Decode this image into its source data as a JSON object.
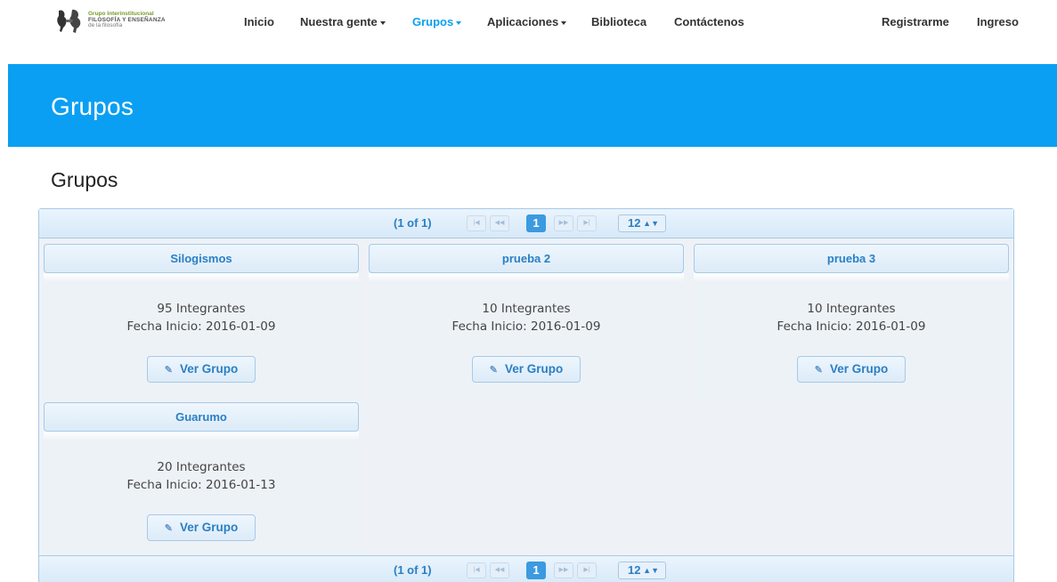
{
  "logo": {
    "line1": "Grupo Interinstitucional",
    "line2": "FILOSOFÍA Y ENSEÑANZA",
    "line3": "de la filosofía"
  },
  "nav": {
    "inicio": "Inicio",
    "nuestra_gente": "Nuestra gente",
    "grupos": "Grupos",
    "aplicaciones": "Aplicaciones",
    "biblioteca": "Biblioteca",
    "contactenos": "Contáctenos",
    "registrarme": "Registrarme",
    "ingreso": "Ingreso"
  },
  "banner": {
    "title": "Grupos"
  },
  "section": {
    "title": "Grupos"
  },
  "paginator": {
    "report": "(1 of 1)",
    "first_icon": "first-page-icon",
    "prev_icon": "previous-page-icon",
    "next_icon": "next-page-icon",
    "last_icon": "last-page-icon",
    "current_page": "1",
    "rows_per_page": "12"
  },
  "groups": [
    {
      "name": "Silogismos",
      "members": "95 Integrantes",
      "start": "Fecha Inicio: 2016-01-09",
      "button": "Ver Grupo"
    },
    {
      "name": "prueba 2",
      "members": "10 Integrantes",
      "start": "Fecha Inicio: 2016-01-09",
      "button": "Ver Grupo"
    },
    {
      "name": "prueba 3",
      "members": "10 Integrantes",
      "start": "Fecha Inicio: 2016-01-09",
      "button": "Ver Grupo"
    },
    {
      "name": "Guarumo",
      "members": "20 Integrantes",
      "start": "Fecha Inicio: 2016-01-13",
      "button": "Ver Grupo"
    }
  ],
  "colors": {
    "brand_blue": "#0a9ff2",
    "link_blue": "#2a7fc4",
    "active_nav": "#0c9ff0"
  }
}
